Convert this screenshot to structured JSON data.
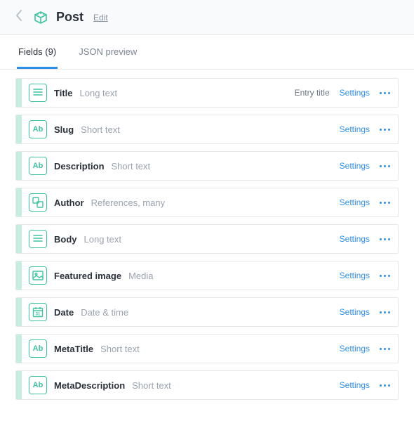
{
  "header": {
    "title": "Post",
    "edit_label": "Edit"
  },
  "tabs": {
    "fields_label": "Fields (9)",
    "json_label": "JSON preview"
  },
  "common": {
    "settings_label": "Settings",
    "entry_title_label": "Entry title"
  },
  "fields": [
    {
      "name": "Title",
      "type": "Long text",
      "icon": "longtext",
      "entry_title": true
    },
    {
      "name": "Slug",
      "type": "Short text",
      "icon": "shorttext"
    },
    {
      "name": "Description",
      "type": "Short text",
      "icon": "shorttext"
    },
    {
      "name": "Author",
      "type": "References, many",
      "icon": "reference"
    },
    {
      "name": "Body",
      "type": "Long text",
      "icon": "longtext"
    },
    {
      "name": "Featured image",
      "type": "Media",
      "icon": "media"
    },
    {
      "name": "Date",
      "type": "Date & time",
      "icon": "date"
    },
    {
      "name": "MetaTitle",
      "type": "Short text",
      "icon": "shorttext"
    },
    {
      "name": "MetaDescription",
      "type": "Short text",
      "icon": "shorttext"
    }
  ]
}
